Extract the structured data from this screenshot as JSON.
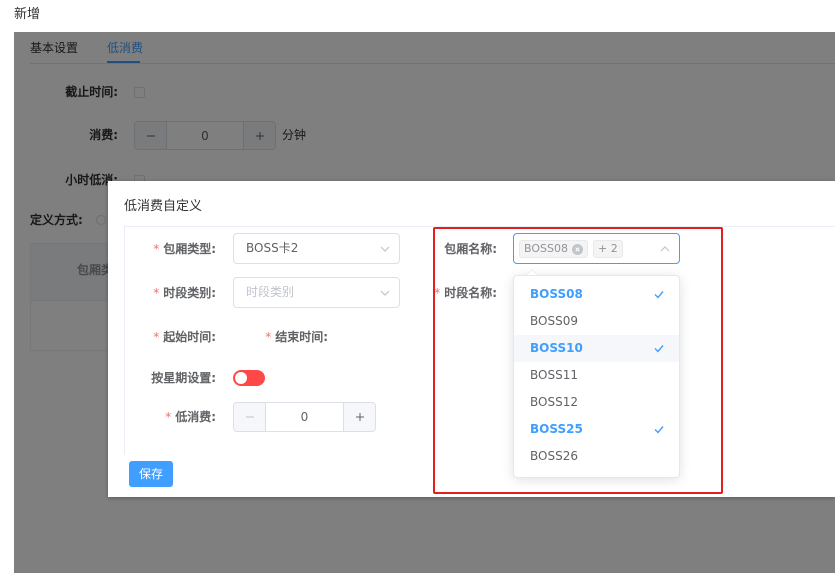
{
  "page": {
    "title": "新增"
  },
  "tabs": [
    {
      "label": "基本设置",
      "active": false
    },
    {
      "label": "低消费",
      "active": true
    }
  ],
  "background_form": {
    "deadline": {
      "label": "截止时间:",
      "checked": false
    },
    "consume": {
      "label": "消费:",
      "value": "0",
      "unit": "分钟"
    },
    "hourly_min": {
      "label": "小时低消:",
      "checked": false
    },
    "define_mode": {
      "label": "定义方式:"
    },
    "table": {
      "headers": [
        "包厢类"
      ]
    }
  },
  "modal": {
    "title": "低消费自定义",
    "required_mark": "*",
    "room_type": {
      "label": "包厢类型:",
      "value": "BOSS卡2",
      "required": true
    },
    "period_category": {
      "label": "时段类别:",
      "placeholder": "时段类别",
      "required": true
    },
    "start_time": {
      "label": "起始时间:",
      "required": true
    },
    "end_time": {
      "label": "结束时间:",
      "required": true
    },
    "week_setting": {
      "label": "按星期设置:",
      "on": false
    },
    "min_consume": {
      "label": "低消费:",
      "value": "0",
      "required": true
    },
    "save_label": "保存",
    "room_name": {
      "label": "包厢名称:",
      "tags": [
        "BOSS08"
      ],
      "collapse_tag": "+ 2"
    },
    "period_name": {
      "label": "时段名称:",
      "required": true
    },
    "room_dropdown": {
      "options": [
        {
          "label": "BOSS08",
          "selected": true,
          "hover": false
        },
        {
          "label": "BOSS09",
          "selected": false,
          "hover": false
        },
        {
          "label": "BOSS10",
          "selected": true,
          "hover": true
        },
        {
          "label": "BOSS11",
          "selected": false,
          "hover": false
        },
        {
          "label": "BOSS12",
          "selected": false,
          "hover": false
        },
        {
          "label": "BOSS25",
          "selected": true,
          "hover": false
        },
        {
          "label": "BOSS26",
          "selected": false,
          "hover": false
        }
      ]
    }
  },
  "icons": {
    "select_arrow": "chevron-down-icon",
    "multi_select_arrow": "chevron-up-icon",
    "tag_close": "circle-close-icon",
    "option_selected": "check-icon",
    "stepper_decrease": "minus-icon",
    "stepper_increase": "plus-icon"
  },
  "colors": {
    "accent": "#409eff",
    "required_mark": "#f56c6c",
    "toggle_off": "#ff4949",
    "annotation_box": "#e02020",
    "mask": "rgba(0,0,0,0.5)"
  }
}
